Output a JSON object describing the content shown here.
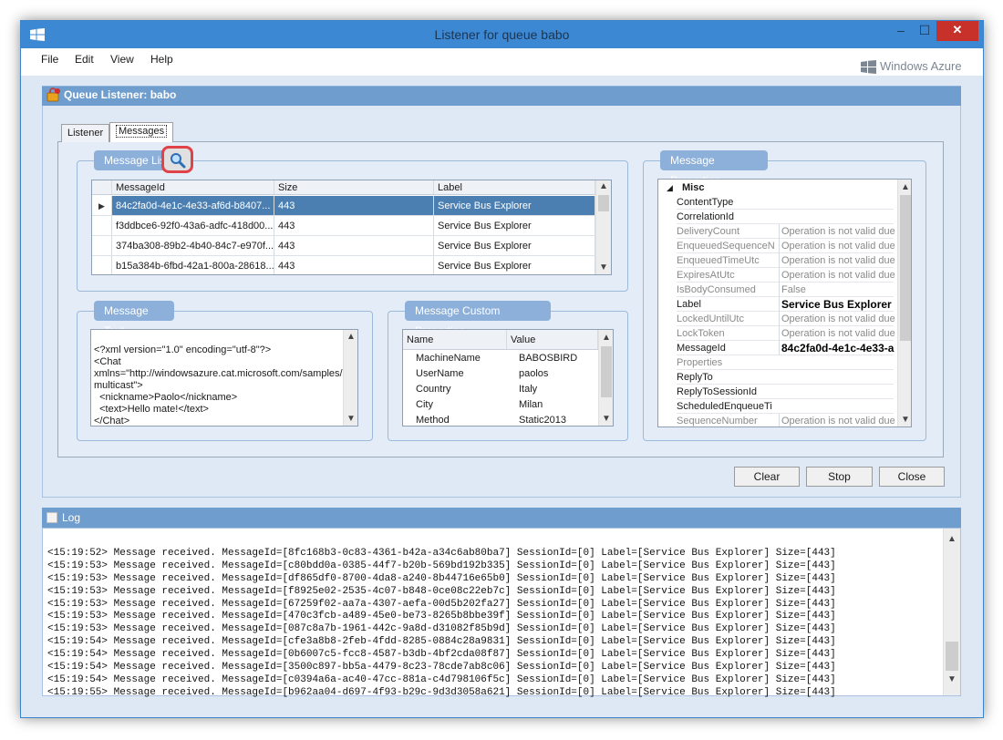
{
  "window": {
    "title": "Listener for queue babo",
    "minimize_glyph": "–",
    "maximize_glyph": "☐",
    "close_glyph": "✕"
  },
  "menu": {
    "file": "File",
    "edit": "Edit",
    "view": "View",
    "help": "Help"
  },
  "brand": {
    "logo_text": "Windows Azure"
  },
  "panel": {
    "title": "Queue Listener: babo"
  },
  "tabs": {
    "listener": "Listener",
    "messages": "Messages"
  },
  "message_list": {
    "title": "Message List",
    "columns": [
      "MessageId",
      "Size",
      "Label"
    ],
    "rows": [
      {
        "id": "84c2fa0d-4e1c-4e33-af6d-b8407...",
        "size": "443",
        "label": "Service Bus Explorer",
        "selected": true
      },
      {
        "id": "f3ddbce6-92f0-43a6-adfc-418d00...",
        "size": "443",
        "label": "Service Bus Explorer",
        "selected": false
      },
      {
        "id": "374ba308-89b2-4b40-84c7-e970f...",
        "size": "443",
        "label": "Service Bus Explorer",
        "selected": false
      },
      {
        "id": "b15a384b-6fbd-42a1-800a-28618...",
        "size": "443",
        "label": "Service Bus Explorer",
        "selected": false
      }
    ]
  },
  "message_text": {
    "title": "Message Text",
    "lines": [
      "<?xml version=\"1.0\" encoding=\"utf-8\"?>",
      "<Chat",
      "xmlns=\"http://windowsazure.cat.microsoft.com/samples/",
      "multicast\">",
      "  <nickname>Paolo</nickname>",
      "  <text>Hello mate!</text>",
      "</Chat>"
    ]
  },
  "custom_props": {
    "title": "Message Custom Properties",
    "columns": [
      "Name",
      "Value"
    ],
    "rows": [
      {
        "name": "MachineName",
        "value": "BABOSBIRD"
      },
      {
        "name": "UserName",
        "value": "paolos"
      },
      {
        "name": "Country",
        "value": "Italy"
      },
      {
        "name": "City",
        "value": "Milan"
      },
      {
        "name": "Method",
        "value": "Static2013"
      }
    ]
  },
  "message_props": {
    "title": "Message Properties",
    "category": "Misc",
    "rows": [
      {
        "name": "ContentType",
        "value": "",
        "readonly": false,
        "bold": false
      },
      {
        "name": "CorrelationId",
        "value": "",
        "readonly": false,
        "bold": false
      },
      {
        "name": "DeliveryCount",
        "value": "Operation is not valid due t",
        "readonly": true,
        "bold": false
      },
      {
        "name": "EnqueuedSequenceN",
        "value": "Operation is not valid due t",
        "readonly": true,
        "bold": false
      },
      {
        "name": "EnqueuedTimeUtc",
        "value": "Operation is not valid due t",
        "readonly": true,
        "bold": false
      },
      {
        "name": "ExpiresAtUtc",
        "value": "Operation is not valid due t",
        "readonly": true,
        "bold": false
      },
      {
        "name": "IsBodyConsumed",
        "value": "False",
        "readonly": true,
        "bold": false
      },
      {
        "name": "Label",
        "value": "Service Bus Explorer",
        "readonly": false,
        "bold": true
      },
      {
        "name": "LockedUntilUtc",
        "value": "Operation is not valid due t",
        "readonly": true,
        "bold": false
      },
      {
        "name": "LockToken",
        "value": "Operation is not valid due t",
        "readonly": true,
        "bold": false
      },
      {
        "name": "MessageId",
        "value": "84c2fa0d-4e1c-4e33-a",
        "readonly": false,
        "bold": true
      },
      {
        "name": "Properties",
        "value": "",
        "readonly": true,
        "bold": false
      },
      {
        "name": "ReplyTo",
        "value": "",
        "readonly": false,
        "bold": false
      },
      {
        "name": "ReplyToSessionId",
        "value": "",
        "readonly": false,
        "bold": false
      },
      {
        "name": "ScheduledEnqueueTi",
        "value": "",
        "readonly": false,
        "bold": false
      },
      {
        "name": "SequenceNumber",
        "value": "Operation is not valid due t",
        "readonly": true,
        "bold": false
      }
    ]
  },
  "buttons": {
    "clear": "Clear",
    "stop": "Stop",
    "close": "Close"
  },
  "log": {
    "title": "Log",
    "lines": [
      "<15:19:52> Message received. MessageId=[8fc168b3-0c83-4361-b42a-a34c6ab80ba7] SessionId=[0] Label=[Service Bus Explorer] Size=[443]",
      "<15:19:53> Message received. MessageId=[c80bdd0a-0385-44f7-b20b-569bd192b335] SessionId=[0] Label=[Service Bus Explorer] Size=[443]",
      "<15:19:53> Message received. MessageId=[df865df0-8700-4da8-a240-8b44716e65b0] SessionId=[0] Label=[Service Bus Explorer] Size=[443]",
      "<15:19:53> Message received. MessageId=[f8925e02-2535-4c07-b848-0ce08c22eb7c] SessionId=[0] Label=[Service Bus Explorer] Size=[443]",
      "<15:19:53> Message received. MessageId=[67259f02-aa7a-4307-aefa-00d5b202fa27] SessionId=[0] Label=[Service Bus Explorer] Size=[443]",
      "<15:19:53> Message received. MessageId=[470c3fcb-a489-45e0-be73-8265b8bbe39f] SessionId=[0] Label=[Service Bus Explorer] Size=[443]",
      "<15:19:53> Message received. MessageId=[087c8a7b-1961-442c-9a8d-d31082f85b9d] SessionId=[0] Label=[Service Bus Explorer] Size=[443]",
      "<15:19:54> Message received. MessageId=[cfe3a8b8-2feb-4fdd-8285-0884c28a9831] SessionId=[0] Label=[Service Bus Explorer] Size=[443]",
      "<15:19:54> Message received. MessageId=[0b6007c5-fcc8-4587-b3db-4bf2cda08f87] SessionId=[0] Label=[Service Bus Explorer] Size=[443]",
      "<15:19:54> Message received. MessageId=[3500c897-bb5a-4479-8c23-78cde7ab8c06] SessionId=[0] Label=[Service Bus Explorer] Size=[443]",
      "<15:19:54> Message received. MessageId=[c0394a6a-ac40-47cc-881a-c4d798106f5c] SessionId=[0] Label=[Service Bus Explorer] Size=[443]",
      "<15:19:55> Message received. MessageId=[b962aa04-d697-4f93-b29c-9d3d3058a621] SessionId=[0] Label=[Service Bus Explorer] Size=[443]"
    ]
  },
  "icons": {
    "window": "windows-logo-icon",
    "panel": "queue-listener-icon",
    "search": "magnifier-icon",
    "log": "log-icon"
  },
  "colors": {
    "titlebar": "#3c88d3",
    "close_button": "#c7312a",
    "group_header": "#8db0da",
    "panel_header": "#6f9dcd",
    "selection": "#4b7fb2"
  }
}
